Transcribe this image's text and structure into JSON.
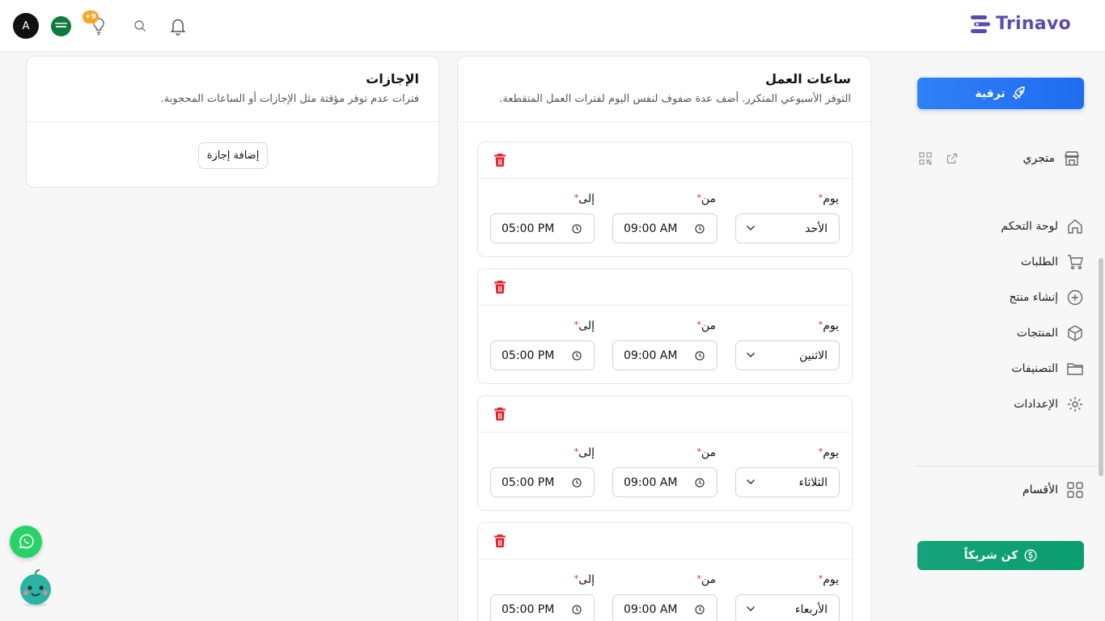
{
  "brand": {
    "name": "Trinavo",
    "color": "#5a4bb0"
  },
  "topbar": {
    "avatar_letter": "A",
    "notification_badge": "+9"
  },
  "sidebar": {
    "upgrade_label": "ترقية",
    "store_label": "متجري",
    "nav": [
      {
        "label": "لوحة التحكم",
        "icon": "home-icon"
      },
      {
        "label": "الطلبات",
        "icon": "cart-icon"
      },
      {
        "label": "إنشاء منتج",
        "icon": "plus-circle-icon"
      },
      {
        "label": "المنتجات",
        "icon": "box-icon"
      },
      {
        "label": "التصنيفات",
        "icon": "folder-icon"
      },
      {
        "label": "الإعدادات",
        "icon": "gear-icon"
      }
    ],
    "sections_label": "الأقسام",
    "partner_label": "كن شريكاً"
  },
  "hours": {
    "title": "ساعات العمل",
    "subtitle": "التوفر الأسبوعي المتكرر. أضف عدة صفوف لنفس اليوم لفترات العمل المتقطعة.",
    "labels": {
      "day": "يوم",
      "from": "من",
      "to": "إلى",
      "required": "*"
    },
    "rows": [
      {
        "day": "الأحد",
        "from": "09:00 AM",
        "to": "05:00 PM"
      },
      {
        "day": "الاثنين",
        "from": "09:00 AM",
        "to": "05:00 PM"
      },
      {
        "day": "الثلاثاء",
        "from": "09:00 AM",
        "to": "05:00 PM"
      },
      {
        "day": "الأربعاء",
        "from": "09:00 AM",
        "to": "05:00 PM"
      }
    ]
  },
  "leaves": {
    "title": "الإجازات",
    "subtitle": "فترات عدم توفر مؤقتة مثل الإجازات أو الساعات المحجوبة.",
    "add_label": "إضافة إجازة"
  },
  "colors": {
    "upgrade": "#2f80f5",
    "partner": "#16a37c",
    "danger": "#e0262d",
    "badge": "#f5a623"
  }
}
